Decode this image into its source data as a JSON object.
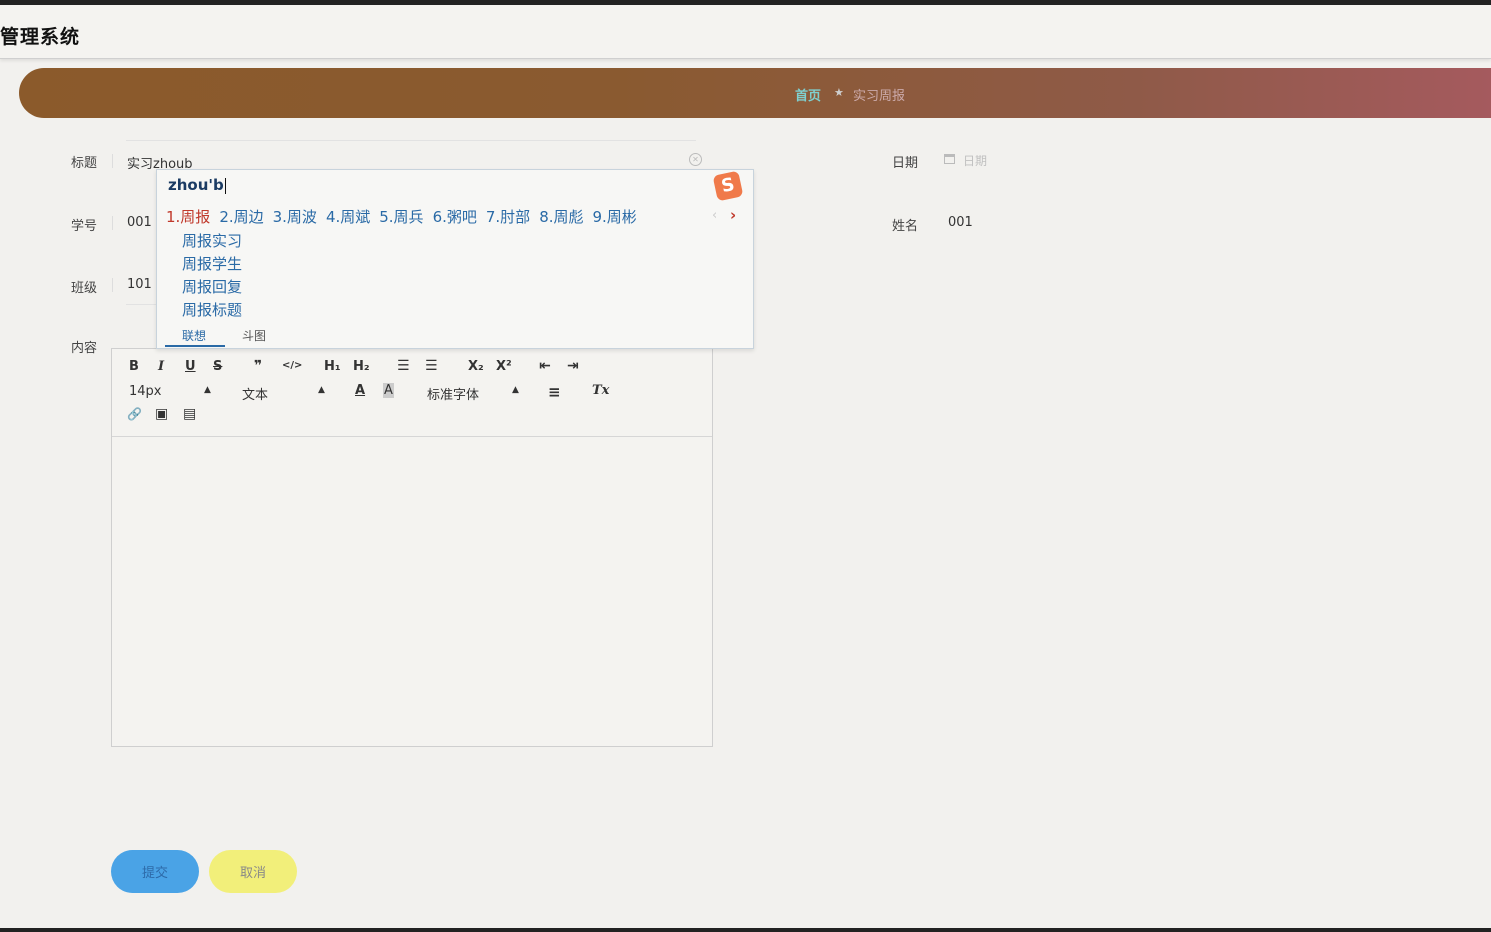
{
  "app": {
    "title": "管理系统"
  },
  "breadcrumb": {
    "home": "首页",
    "separator": "★",
    "current": "实习周报"
  },
  "form": {
    "title_label": "标题",
    "title_value": "实习zhoub",
    "date_label": "日期",
    "date_placeholder": "日期",
    "student_no_label": "学号",
    "student_no_value": "001",
    "name_label": "姓名",
    "name_value": "001",
    "class_label": "班级",
    "class_value": "101",
    "content_label": "内容"
  },
  "ime": {
    "composition": "zhou'b",
    "logo": "S",
    "candidates": [
      "1.周报",
      "2.周边",
      "3.周波",
      "4.周斌",
      "5.周兵",
      "6.粥吧",
      "7.肘部",
      "8.周彪",
      "9.周彬"
    ],
    "prev": "‹",
    "next": "›",
    "suggestions": [
      "周报实习",
      "周报学生",
      "周报回复",
      "周报标题"
    ],
    "tabs": [
      "联想",
      "斗图"
    ]
  },
  "editor": {
    "toolbar": {
      "bold": "B",
      "italic": "I",
      "underline": "U",
      "strike": "S",
      "quote": "❞",
      "code": "</>",
      "h1": "H₁",
      "h2": "H₂",
      "ol": "☰",
      "ul": "☰",
      "sub": "X₂",
      "sup": "X²",
      "outdent": "⇤",
      "indent": "⇥",
      "size": "14px",
      "header": "文本",
      "font": "标准字体",
      "color": "A",
      "background": "A",
      "align": "≡",
      "clean": "Tx",
      "link": "🔗",
      "image": "▣",
      "video": "▤"
    }
  },
  "buttons": {
    "submit": "提交",
    "cancel": "取消"
  },
  "colors": {
    "banner_start": "#8b5a2b",
    "banner_end": "#a65a5f",
    "submit": "#4aa3e6",
    "cancel": "#f2ef7a",
    "ime_highlight": "#c0392b",
    "ime_text": "#2a6aa6"
  }
}
